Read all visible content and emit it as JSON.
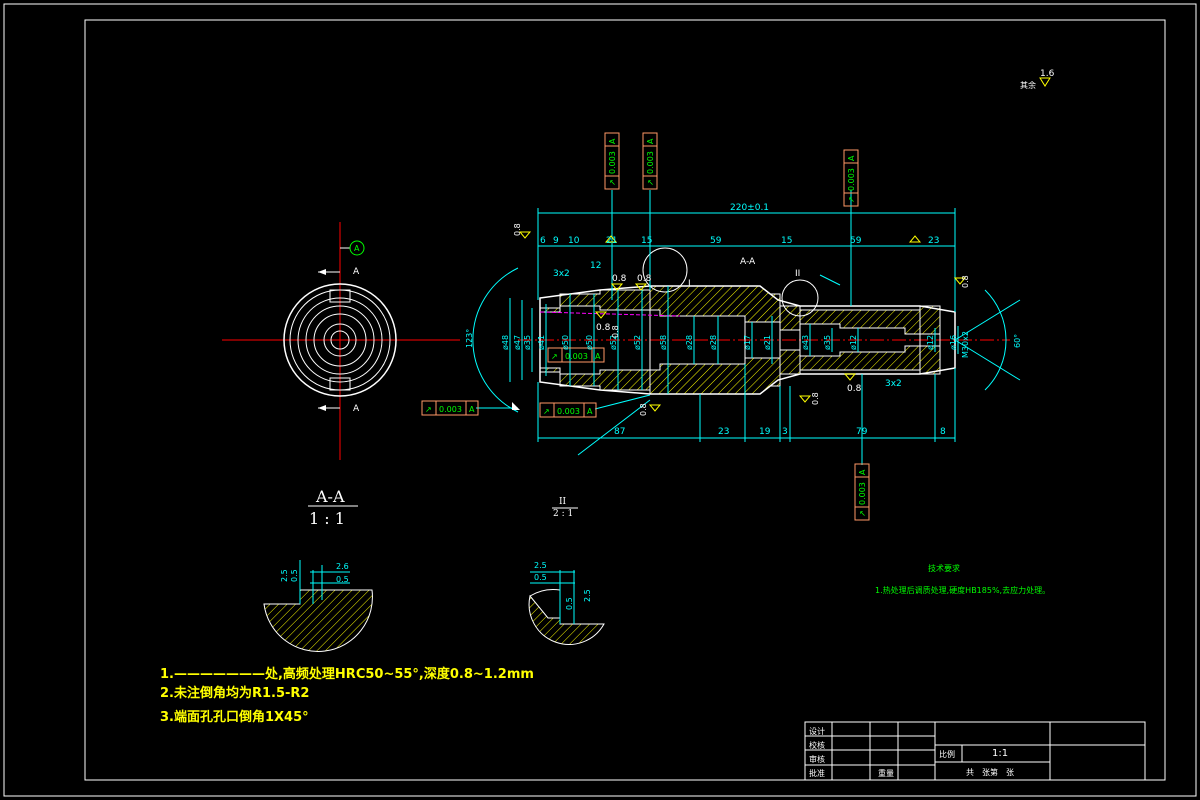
{
  "dimensions": {
    "overall": "220±0.1",
    "top": [
      "6",
      "9",
      "10",
      "21",
      "15",
      "59",
      "15",
      "59",
      "23"
    ],
    "bottom": [
      "87",
      "23",
      "19",
      "3",
      "79",
      "8"
    ],
    "diameters": [
      "ø48",
      "ø47",
      "ø35",
      "ø41",
      "ø50",
      "ø50",
      "ø52",
      "ø52",
      "ø58",
      "ø28",
      "ø28",
      "ø17",
      "ø21",
      "ø43",
      "ø35",
      "ø12",
      "ø12",
      "ø16",
      "M30x2"
    ],
    "chamfers": [
      "3x2",
      "12",
      "3x2"
    ],
    "angles": [
      "123°",
      "60°"
    ],
    "roughness": [
      "0.8",
      "0.8",
      "0.8",
      "0.8",
      "0.8",
      "0.8",
      "0.8",
      "0.8",
      "0.8"
    ],
    "corner_roughness": "1.6",
    "view_label": "A-A",
    "detail_marks": [
      "I",
      "II"
    ]
  },
  "tolerance_frames": [
    {
      "symbol": "↗",
      "value": "0.003",
      "datum": "A"
    },
    {
      "symbol": "↗",
      "value": "0.003",
      "datum": "A"
    },
    {
      "symbol": "↗",
      "value": "0.003",
      "datum": "A"
    },
    {
      "symbol": "↗",
      "value": "0.003",
      "datum": "A"
    },
    {
      "symbol": "↗",
      "value": "0.003",
      "datum": "A"
    },
    {
      "symbol": "↗",
      "value": "0.003",
      "datum": "A"
    },
    {
      "symbol": "↗",
      "value": "0.003",
      "datum": "A"
    }
  ],
  "section_view": {
    "label": "A-A",
    "scale": "1 : 1",
    "cut_marks": [
      "A",
      "A"
    ],
    "datum": "A"
  },
  "detail_view": {
    "label": "II",
    "scale": "2 : 1"
  },
  "detail_left_dims": [
    "2.5",
    "0.5",
    "2.6",
    "0.5"
  ],
  "detail_right_dims": [
    "2.5",
    "0.5",
    "0.5",
    "2.5"
  ],
  "notes": [
    "1.———————处,高频处理HRC50~55°,深度0.8~1.2mm",
    "2.未注倒角均为R1.5-R2",
    "3.端面孔孔口倒角1X45°"
  ],
  "tech_req": {
    "title": "技术要求",
    "text": "1.热处理后调质处理,硬度HB185%,去应力处理。"
  },
  "title_block": {
    "rows": [
      "设计",
      "校核",
      "审核",
      "批准"
    ],
    "scale_label": "比例",
    "scale_value": "1:1",
    "part_label": "共　张第　张",
    "weight_label": "重量",
    "callout": "其余"
  },
  "colors": {
    "background": "#000000",
    "outline": "#ffffff",
    "dimension": "#00ffff",
    "center_line": "#ff0000",
    "hatch": "#ffff00",
    "tolerance": "#ff9966",
    "tolerance_text": "#00ff00",
    "notes": "#ffff00"
  }
}
